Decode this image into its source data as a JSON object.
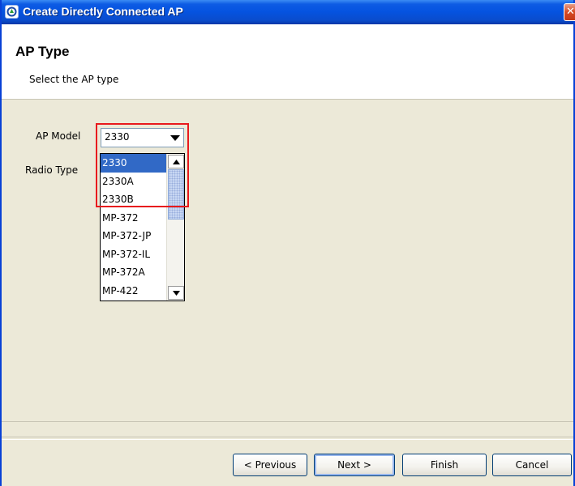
{
  "window": {
    "title": "Create Directly Connected AP"
  },
  "header": {
    "title": "AP Type",
    "subtitle": "Select the AP type"
  },
  "form": {
    "ap_model_label": "AP Model",
    "radio_type_label": "Radio Type",
    "ap_model_value": "2330",
    "ap_model_options": [
      "2330",
      "2330A",
      "2330B",
      "MP-372",
      "MP-372-JP",
      "MP-372-IL",
      "MP-372A",
      "MP-422"
    ],
    "selected_option": "2330"
  },
  "buttons": {
    "previous": "< Previous",
    "next": "Next >",
    "finish": "Finish",
    "cancel": "Cancel"
  },
  "colors": {
    "title_bar": "#0553e0",
    "selection": "#3169c6",
    "highlight_box": "#e8191d"
  },
  "icons": [
    "app-icon",
    "close-icon",
    "chevron-down-icon",
    "scroll-up-icon",
    "scroll-down-icon"
  ]
}
